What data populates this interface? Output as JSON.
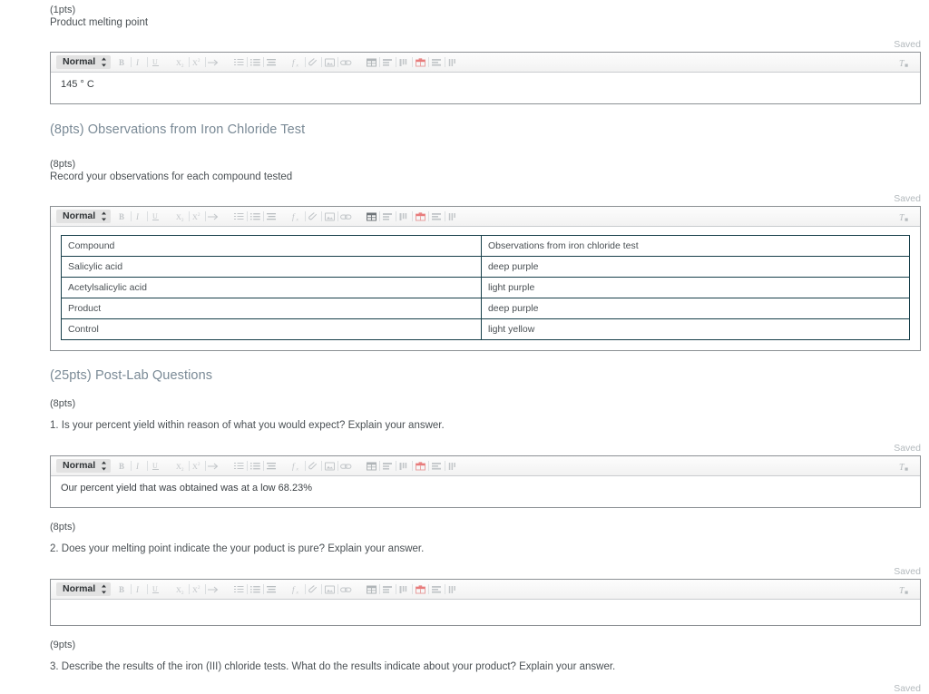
{
  "document": {
    "status_label": "Saved"
  },
  "blocks": [
    {
      "id": "melting-point",
      "points": "(1pts)",
      "prompt": "Product melting point",
      "answer": "145 ° C"
    }
  ],
  "sections": {
    "iron_chloride": {
      "title": "(8pts) Observations from Iron Chloride Test",
      "points": "(8pts)",
      "prompt": "Record your observations for each compound tested",
      "table": {
        "headers": [
          "Compound",
          "Observations from iron chloride test"
        ],
        "rows": [
          [
            "Salicylic acid",
            "deep purple"
          ],
          [
            "Acetylsalicylic acid",
            "light purple"
          ],
          [
            "Product",
            "deep purple"
          ],
          [
            "Control",
            "light yellow"
          ]
        ]
      }
    },
    "post_lab": {
      "title": "(25pts) Post-Lab Questions",
      "questions": [
        {
          "points": "(8pts)",
          "prompt": "1. Is your percent yield within reason of what you would expect? Explain your answer.",
          "answer": "Our percent yield that was obtained was at a low 68.23%"
        },
        {
          "points": "(8pts)",
          "prompt": "2. Does your melting point indicate the your poduct is pure? Explain your answer.",
          "answer": ""
        },
        {
          "points": "(9pts)",
          "prompt": "3. Describe the results of the iron (III) chloride tests. What do the results indicate about your product? Explain your answer.",
          "answer": ""
        }
      ]
    }
  },
  "toolbar": {
    "style_label": "Normal",
    "icons": [
      "bold-icon",
      "italic-icon",
      "underline-icon",
      "subscript-icon",
      "superscript-icon",
      "indent-arrow-icon",
      "numbered-list-icon",
      "bullet-list-icon",
      "align-icon",
      "formula-icon",
      "attachment-icon",
      "image-icon",
      "link-icon",
      "insert-table-icon",
      "insert-row-icon",
      "insert-column-icon",
      "delete-table-icon",
      "merge-cells-icon",
      "table-properties-icon",
      "clear-formatting-icon"
    ],
    "accent_delete_color": "#e87b7b"
  }
}
